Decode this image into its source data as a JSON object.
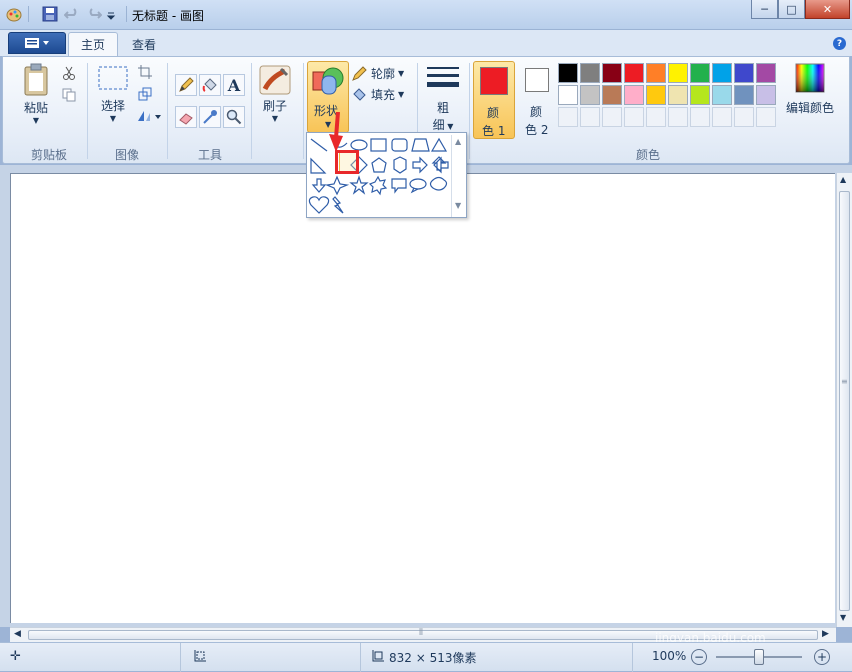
{
  "window": {
    "title": "无标题 - 画图",
    "minimize": "─",
    "maximize": "□",
    "close": "✕"
  },
  "tabs": {
    "home": "主页",
    "view": "查看"
  },
  "clipboard": {
    "paste": "粘贴",
    "label": "剪贴板"
  },
  "image": {
    "select": "选择",
    "label": "图像"
  },
  "tools": {
    "label": "工具",
    "text_glyph": "A"
  },
  "brushes": {
    "label": "刷子"
  },
  "shapes": {
    "label": "形状",
    "outline": "轮廓",
    "fill": "填充"
  },
  "size": {
    "label_top": "粗",
    "label_bottom": "细"
  },
  "colors": {
    "color1_top": "颜",
    "color1_bottom": "色 1",
    "color2_top": "颜",
    "color2_bottom": "色 2",
    "edit": "编辑颜色",
    "label": "颜色",
    "row1": [
      "#000000",
      "#7f7f7f",
      "#880015",
      "#ed1c24",
      "#ff7f27",
      "#fff200",
      "#22b14c",
      "#00a2e8",
      "#3f48cc",
      "#a349a4"
    ],
    "row2": [
      "#ffffff",
      "#c3c3c3",
      "#b97a57",
      "#ffaec9",
      "#ffc90e",
      "#efe4b0",
      "#b5e61d",
      "#99d9ea",
      "#7092be",
      "#c8bfe7"
    ],
    "color1": "#ed1c24",
    "color2": "#ffffff"
  },
  "status": {
    "canvas_size": "832 × 513像素",
    "zoom": "100%",
    "zoom_out": "−",
    "zoom_in": "+"
  },
  "watermark": {
    "main": "Baidu 经验",
    "sub": "jingyan.baidu.com"
  }
}
